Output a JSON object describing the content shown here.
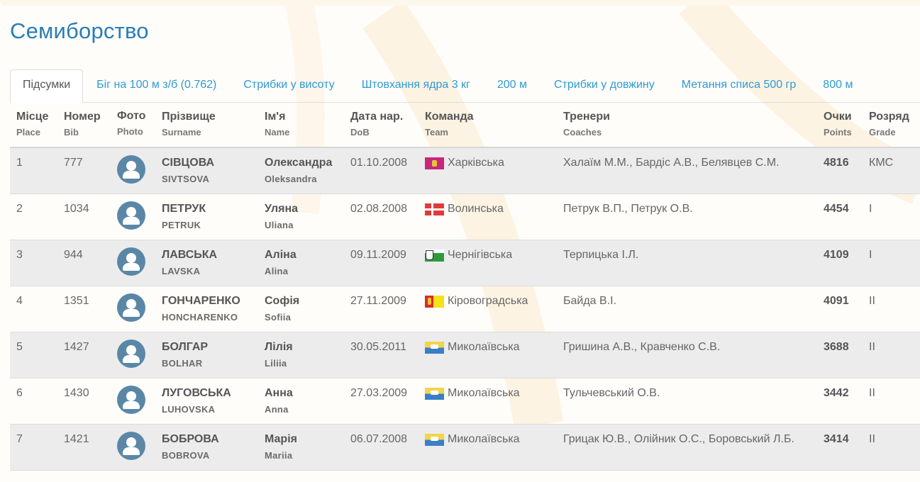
{
  "title": "Семиборство",
  "tabs": [
    {
      "label": "Підсумки",
      "active": true
    },
    {
      "label": "Біг на 100 м з/б (0.762)"
    },
    {
      "label": "Стрибки у висоту"
    },
    {
      "label": "Штовхання ядра 3 кг"
    },
    {
      "label": "200 м"
    },
    {
      "label": "Стрибки у довжину"
    },
    {
      "label": "Метання списа 500 гр"
    },
    {
      "label": "800 м"
    }
  ],
  "headers": {
    "place": {
      "uk": "Місце",
      "en": "Place"
    },
    "bib": {
      "uk": "Номер",
      "en": "Bib"
    },
    "photo": {
      "uk": "Фото",
      "en": "Photo"
    },
    "surname": {
      "uk": "Прізвище",
      "en": "Surname"
    },
    "name": {
      "uk": "Ім'я",
      "en": "Name"
    },
    "dob": {
      "uk": "Дата нар.",
      "en": "DoB"
    },
    "team": {
      "uk": "Команда",
      "en": "Team"
    },
    "coaches": {
      "uk": "Тренери",
      "en": "Coaches"
    },
    "points": {
      "uk": "Очки",
      "en": "Points"
    },
    "grade": {
      "uk": "Розряд",
      "en": "Grade"
    }
  },
  "rows": [
    {
      "place": "1",
      "bib": "777",
      "surname": "СІВЦОВА",
      "surname_en": "SIVTSOVA",
      "name": "Олександра",
      "name_en": "Oleksandra",
      "dob": "01.10.2008",
      "team": "Харківська",
      "team_flag": "kharkiv-flag-icon",
      "coaches": "Халаїм М.М., Бардіс А.В., Белявцев С.М.",
      "points": "4816",
      "grade": "КМС"
    },
    {
      "place": "2",
      "bib": "1034",
      "surname": "ПЕТРУК",
      "surname_en": "PETRUK",
      "name": "Уляна",
      "name_en": "Uliana",
      "dob": "02.08.2008",
      "team": "Волинська",
      "team_flag": "volyn-flag-icon",
      "coaches": "Петрук В.П., Петрук О.В.",
      "points": "4454",
      "grade": "I"
    },
    {
      "place": "3",
      "bib": "944",
      "surname": "ЛАВСЬКА",
      "surname_en": "LAVSKA",
      "name": "Аліна",
      "name_en": "Alina",
      "dob": "09.11.2009",
      "team": "Чернігівська",
      "team_flag": "chernihiv-flag-icon",
      "coaches": "Терпицька І.Л.",
      "points": "4109",
      "grade": "I"
    },
    {
      "place": "4",
      "bib": "1351",
      "surname": "ГОНЧАРЕНКО",
      "surname_en": "HONCHARENKO",
      "name": "Софія",
      "name_en": "Sofiia",
      "dob": "27.11.2009",
      "team": "Кіровоградська",
      "team_flag": "kirovohrad-flag-icon",
      "coaches": "Байда В.І.",
      "points": "4091",
      "grade": "II"
    },
    {
      "place": "5",
      "bib": "1427",
      "surname": "БОЛГАР",
      "surname_en": "BOLHAR",
      "name": "Лілія",
      "name_en": "Liliia",
      "dob": "30.05.2011",
      "team": "Миколаївська",
      "team_flag": "mykolaiv-flag-icon",
      "coaches": "Гришина А.В., Кравченко С.В.",
      "points": "3688",
      "grade": "II"
    },
    {
      "place": "6",
      "bib": "1430",
      "surname": "ЛУГОВСЬКА",
      "surname_en": "LUHOVSKA",
      "name": "Анна",
      "name_en": "Anna",
      "dob": "27.03.2009",
      "team": "Миколаївська",
      "team_flag": "mykolaiv-flag-icon",
      "coaches": "Тульчевський О.В.",
      "points": "3442",
      "grade": "II"
    },
    {
      "place": "7",
      "bib": "1421",
      "surname": "БОБРОВА",
      "surname_en": "BOBROVA",
      "name": "Марія",
      "name_en": "Mariia",
      "dob": "06.07.2008",
      "team": "Миколаївська",
      "team_flag": "mykolaiv-flag-icon",
      "coaches": "Грицак Ю.В., Олійник О.С., Боровський Л.Б.",
      "points": "3414",
      "grade": "II"
    }
  ]
}
